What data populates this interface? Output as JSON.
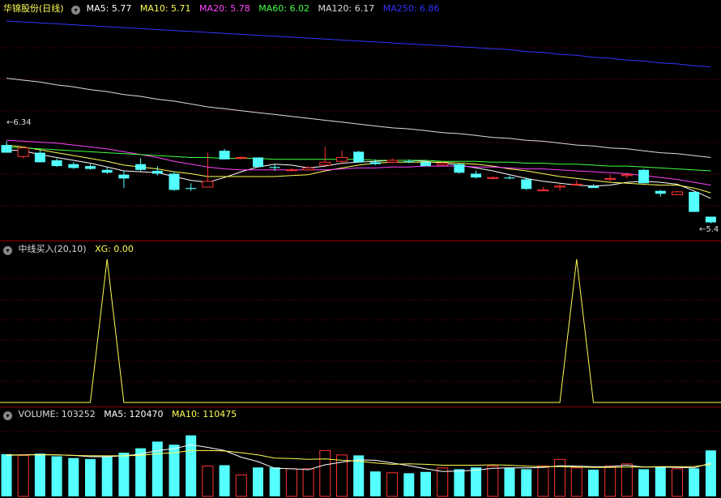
{
  "main_panel": {
    "stock_name": "华锦股份",
    "period": "(日线)",
    "ma5": {
      "label": "MA5:",
      "value": "5.77",
      "color": "#ffffff"
    },
    "ma10": {
      "label": "MA10:",
      "value": "5.71",
      "color": "#ffff55"
    },
    "ma20": {
      "label": "MA20:",
      "value": "5.78",
      "color": "#ff44ff"
    },
    "ma60": {
      "label": "MA60:",
      "value": "6.02",
      "color": "#44ff44"
    },
    "ma120": {
      "label": "MA120:",
      "value": "6.17",
      "color": "#dddddd"
    },
    "ma250": {
      "label": "MA250:",
      "value": "6.86",
      "color": "#3333ff"
    },
    "high_marker": "6.34",
    "low_marker": "5.4"
  },
  "indicator_panel": {
    "name": "中线买入(20,10)",
    "xg_label": "XG:",
    "xg_value": "0.00",
    "xg_color": "#ffff55"
  },
  "volume_panel": {
    "volume_label": "VOLUME:",
    "volume_value": "103252",
    "ma5_label": "MA5:",
    "ma5_value": "120470",
    "ma10_label": "MA10:",
    "ma10_value": "110475"
  },
  "colors": {
    "up": "#ff3232",
    "down": "#54ffff",
    "grid": "#8b0000"
  },
  "chart_data": [
    {
      "type": "candlestick",
      "series": [
        {
          "name": "K",
          "ohlc": [
            [
              6.3,
              6.34,
              6.22,
              6.22
            ],
            [
              6.18,
              6.28,
              6.16,
              6.27
            ],
            [
              6.22,
              6.25,
              6.12,
              6.12
            ],
            [
              6.14,
              6.16,
              6.07,
              6.08
            ],
            [
              6.1,
              6.12,
              6.05,
              6.06
            ],
            [
              6.08,
              6.1,
              6.04,
              6.05
            ],
            [
              6.04,
              6.07,
              6.0,
              6.01
            ],
            [
              5.99,
              6.03,
              5.85,
              5.95
            ],
            [
              6.1,
              6.16,
              6.02,
              6.04
            ],
            [
              6.03,
              6.08,
              5.98,
              6.0
            ],
            [
              6.0,
              6.02,
              5.82,
              5.83
            ],
            [
              5.85,
              5.9,
              5.82,
              5.84
            ],
            [
              5.86,
              6.22,
              5.86,
              5.92
            ],
            [
              6.24,
              6.26,
              6.15,
              6.15
            ],
            [
              6.17,
              6.18,
              6.15,
              6.17
            ],
            [
              6.17,
              6.17,
              6.07,
              6.07
            ],
            [
              6.07,
              6.1,
              6.03,
              6.06
            ],
            [
              6.04,
              6.06,
              6.03,
              6.04
            ],
            [
              6.04,
              6.08,
              6.03,
              6.06
            ],
            [
              6.09,
              6.28,
              6.08,
              6.12
            ],
            [
              6.13,
              6.24,
              6.1,
              6.17
            ],
            [
              6.23,
              6.24,
              6.12,
              6.12
            ],
            [
              6.12,
              6.15,
              6.09,
              6.1
            ],
            [
              6.12,
              6.16,
              6.11,
              6.14
            ],
            [
              6.13,
              6.15,
              6.11,
              6.12
            ],
            [
              6.12,
              6.14,
              6.08,
              6.08
            ],
            [
              6.09,
              6.12,
              6.08,
              6.11
            ],
            [
              6.1,
              6.11,
              6.0,
              6.01
            ],
            [
              6.0,
              6.03,
              5.95,
              5.96
            ],
            [
              5.95,
              5.97,
              5.94,
              5.96
            ],
            [
              5.96,
              5.98,
              5.94,
              5.95
            ],
            [
              5.94,
              5.96,
              5.83,
              5.84
            ],
            [
              5.82,
              5.86,
              5.82,
              5.83
            ],
            [
              5.86,
              5.89,
              5.82,
              5.87
            ],
            [
              5.89,
              5.93,
              5.88,
              5.89
            ],
            [
              5.87,
              5.89,
              5.85,
              5.85
            ],
            [
              5.94,
              5.99,
              5.92,
              5.95
            ],
            [
              5.98,
              6.01,
              5.95,
              5.99
            ],
            [
              6.04,
              6.05,
              5.9,
              5.9
            ],
            [
              5.82,
              5.83,
              5.76,
              5.79
            ],
            [
              5.78,
              5.82,
              5.78,
              5.81
            ],
            [
              5.81,
              5.81,
              5.6,
              5.6
            ],
            [
              5.55,
              5.55,
              5.48,
              5.49
            ]
          ]
        }
      ],
      "ma_series": [
        {
          "name": "MA5",
          "values": [
            6.25,
            6.24,
            6.2,
            6.17,
            6.14,
            6.11,
            6.07,
            6.03,
            6.02,
            6.01,
            5.97,
            5.93,
            5.91,
            5.96,
            6.02,
            6.07,
            6.1,
            6.09,
            6.06,
            6.08,
            6.11,
            6.12,
            6.13,
            6.14,
            6.14,
            6.13,
            6.11,
            6.09,
            6.06,
            6.03,
            5.99,
            5.95,
            5.92,
            5.9,
            5.88,
            5.87,
            5.88,
            5.91,
            5.92,
            5.91,
            5.89,
            5.82,
            5.74
          ]
        },
        {
          "name": "MA10",
          "values": [
            6.3,
            6.28,
            6.25,
            6.22,
            6.19,
            6.16,
            6.13,
            6.09,
            6.07,
            6.05,
            6.02,
            6.0,
            5.97,
            5.97,
            5.97,
            5.97,
            5.97,
            5.98,
            5.99,
            6.03,
            6.06,
            6.09,
            6.11,
            6.12,
            6.12,
            6.12,
            6.12,
            6.11,
            6.1,
            6.08,
            6.05,
            6.03,
            6.0,
            5.97,
            5.95,
            5.93,
            5.91,
            5.9,
            5.89,
            5.88,
            5.88,
            5.85,
            5.8
          ]
        },
        {
          "name": "MA20",
          "values": [
            6.35,
            6.34,
            6.33,
            6.32,
            6.3,
            6.28,
            6.26,
            6.23,
            6.2,
            6.17,
            6.13,
            6.1,
            6.07,
            6.05,
            6.04,
            6.04,
            6.04,
            6.04,
            6.04,
            6.04,
            6.05,
            6.06,
            6.06,
            6.07,
            6.07,
            6.08,
            6.08,
            6.08,
            6.07,
            6.07,
            6.06,
            6.05,
            6.05,
            6.04,
            6.03,
            6.02,
            6.01,
            6.0,
            5.98,
            5.96,
            5.94,
            5.91,
            5.88
          ]
        },
        {
          "name": "MA60",
          "values": [
            6.28,
            6.27,
            6.26,
            6.25,
            6.24,
            6.23,
            6.22,
            6.21,
            6.2,
            6.19,
            6.18,
            6.17,
            6.17,
            6.16,
            6.16,
            6.16,
            6.15,
            6.15,
            6.15,
            6.15,
            6.15,
            6.15,
            6.14,
            6.14,
            6.14,
            6.14,
            6.13,
            6.13,
            6.13,
            6.12,
            6.12,
            6.11,
            6.11,
            6.1,
            6.1,
            6.09,
            6.08,
            6.08,
            6.07,
            6.06,
            6.05,
            6.04,
            6.03
          ]
        },
        {
          "name": "MA120",
          "values": [
            7.0,
            6.98,
            6.96,
            6.93,
            6.91,
            6.88,
            6.86,
            6.83,
            6.81,
            6.78,
            6.76,
            6.73,
            6.7,
            6.68,
            6.66,
            6.64,
            6.62,
            6.6,
            6.58,
            6.56,
            6.54,
            6.52,
            6.5,
            6.48,
            6.47,
            6.45,
            6.43,
            6.42,
            6.4,
            6.38,
            6.37,
            6.35,
            6.34,
            6.32,
            6.3,
            6.29,
            6.27,
            6.26,
            6.24,
            6.22,
            6.21,
            6.19,
            6.17
          ]
        },
        {
          "name": "MA250",
          "values": [
            7.6,
            7.59,
            7.58,
            7.57,
            7.56,
            7.55,
            7.54,
            7.53,
            7.52,
            7.51,
            7.5,
            7.49,
            7.48,
            7.47,
            7.46,
            7.45,
            7.44,
            7.43,
            7.42,
            7.41,
            7.4,
            7.39,
            7.38,
            7.37,
            7.36,
            7.35,
            7.34,
            7.33,
            7.32,
            7.31,
            7.3,
            7.28,
            7.27,
            7.25,
            7.24,
            7.22,
            7.21,
            7.19,
            7.18,
            7.16,
            7.15,
            7.13,
            7.12
          ]
        }
      ],
      "ylim": [
        5.3,
        7.65
      ]
    },
    {
      "type": "line",
      "series": [
        {
          "name": "XG",
          "values": [
            0,
            0,
            0,
            0,
            0,
            0,
            1,
            0,
            0,
            0,
            0,
            0,
            0,
            0,
            0,
            0,
            0,
            0,
            0,
            0,
            0,
            0,
            0,
            0,
            0,
            0,
            0,
            0,
            0,
            0,
            0,
            0,
            0,
            0,
            1,
            0,
            0,
            0,
            0,
            0,
            0,
            0,
            0
          ]
        }
      ],
      "ylim": [
        0,
        1
      ]
    },
    {
      "type": "bar",
      "series": [
        {
          "name": "VOLUME",
          "values": [
            95000,
            92000,
            96000,
            90000,
            86000,
            84000,
            90000,
            98000,
            108000,
            123000,
            116000,
            137000,
            68000,
            70000,
            48000,
            65000,
            65000,
            62000,
            62000,
            103000,
            93000,
            92000,
            56000,
            53000,
            52000,
            55000,
            64000,
            61000,
            65000,
            68000,
            64000,
            61000,
            68000,
            83000,
            64000,
            60000,
            68000,
            73000,
            61000,
            67000,
            62000,
            63000,
            103252
          ]
        },
        {
          "name": "MA5",
          "values": [
            92000,
            93000,
            94000,
            93000,
            92000,
            89000,
            89000,
            91000,
            95000,
            103000,
            107000,
            116000,
            110000,
            103000,
            88000,
            78000,
            63000,
            62000,
            60000,
            71000,
            77000,
            82000,
            81000,
            75000,
            69000,
            62000,
            56000,
            57000,
            59000,
            63000,
            64000,
            64000,
            65000,
            69000,
            68000,
            67000,
            67000,
            70000,
            66000,
            66000,
            65000,
            64000,
            75000
          ]
        },
        {
          "name": "MA10",
          "values": [
            93000,
            93000,
            93000,
            93000,
            92000,
            91000,
            91000,
            91000,
            92000,
            96000,
            98000,
            103000,
            103000,
            102000,
            98000,
            93000,
            86000,
            85000,
            83000,
            84000,
            81000,
            79000,
            75000,
            72000,
            73000,
            72000,
            70000,
            70000,
            70000,
            71000,
            70000,
            68000,
            67000,
            67000,
            66000,
            65000,
            65000,
            66000,
            66000,
            67000,
            67000,
            67000,
            72000
          ]
        }
      ],
      "ylim": [
        0,
        200000
      ]
    }
  ]
}
